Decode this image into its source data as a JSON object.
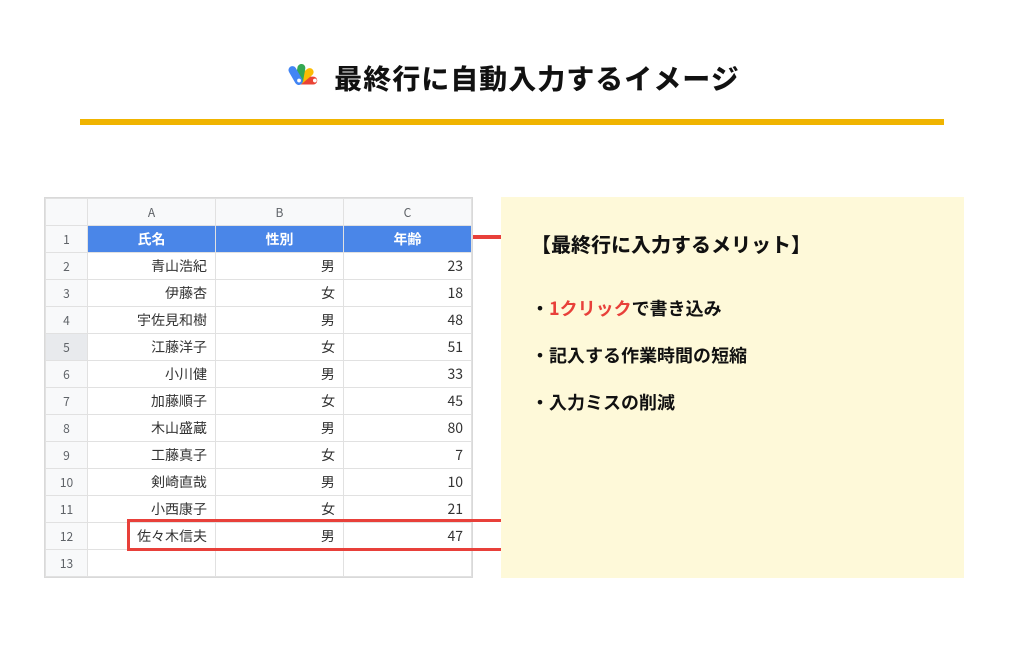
{
  "header": {
    "title": "最終行に自動入力するイメージ"
  },
  "spreadsheet": {
    "col_labels": [
      "A",
      "B",
      "C"
    ],
    "row_labels": [
      "1",
      "2",
      "3",
      "4",
      "5",
      "6",
      "7",
      "8",
      "9",
      "10",
      "11",
      "12",
      "13"
    ],
    "headers": [
      "氏名",
      "性別",
      "年齢"
    ],
    "rows": [
      {
        "name": "青山浩紀",
        "gender": "男",
        "age": "23"
      },
      {
        "name": "伊藤杏",
        "gender": "女",
        "age": "18"
      },
      {
        "name": "宇佐見和樹",
        "gender": "男",
        "age": "48"
      },
      {
        "name": "江藤洋子",
        "gender": "女",
        "age": "51"
      },
      {
        "name": "小川健",
        "gender": "男",
        "age": "33"
      },
      {
        "name": "加藤順子",
        "gender": "女",
        "age": "45"
      },
      {
        "name": "木山盛蔵",
        "gender": "男",
        "age": "80"
      },
      {
        "name": "工藤真子",
        "gender": "女",
        "age": "7"
      },
      {
        "name": "剣崎直哉",
        "gender": "男",
        "age": "10"
      },
      {
        "name": "小西康子",
        "gender": "女",
        "age": "21"
      },
      {
        "name": "佐々木信夫",
        "gender": "男",
        "age": "47"
      }
    ]
  },
  "callout": {
    "title": "【最終行に入力するメリット】",
    "bullet_prefix": "・",
    "items": [
      {
        "accent": "1クリック",
        "rest": "で書き込み"
      },
      {
        "accent": "",
        "rest": "記入する作業時間の短縮"
      },
      {
        "accent": "",
        "rest": "入力ミスの削減"
      }
    ]
  }
}
